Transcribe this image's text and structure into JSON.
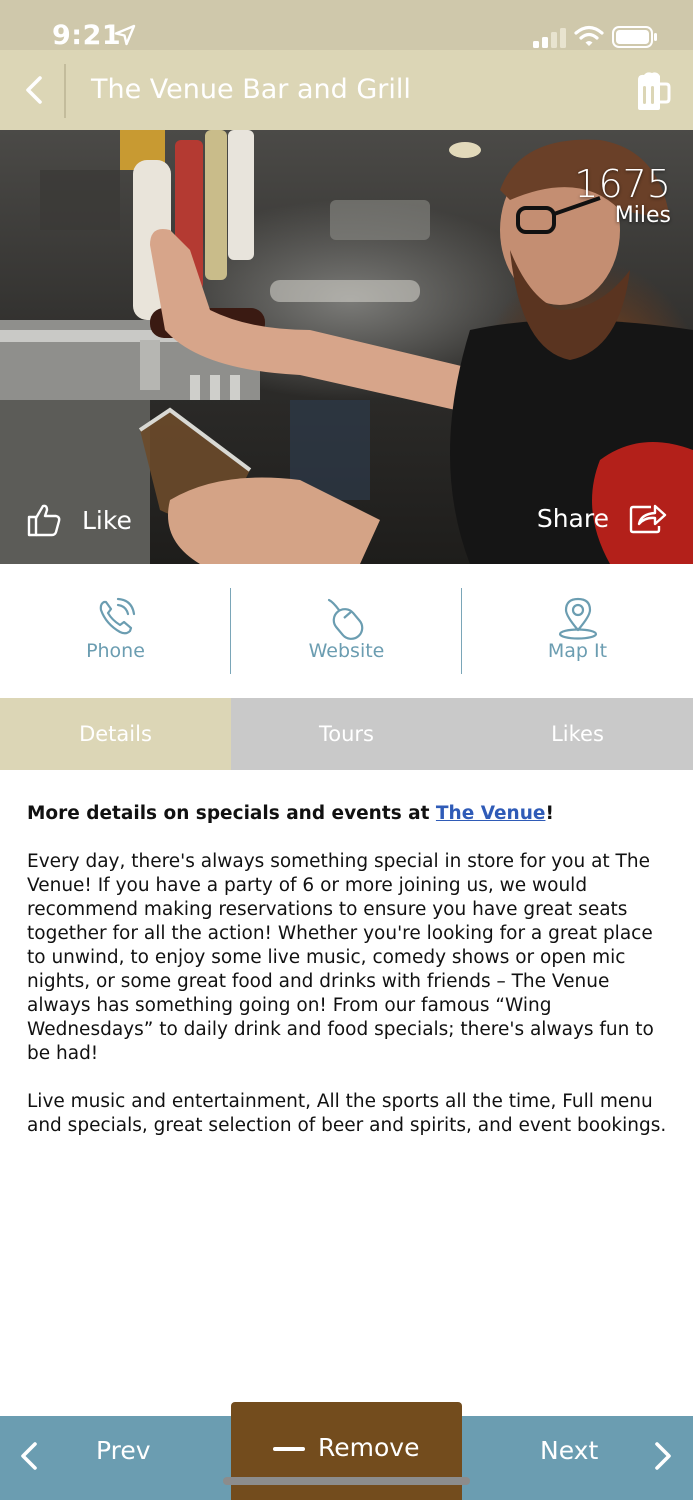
{
  "status_bar": {
    "time": "9:21",
    "icons": [
      "location-arrow-icon",
      "cellular-signal-icon",
      "wifi-icon",
      "battery-icon"
    ]
  },
  "header": {
    "title": "The Venue Bar and Grill",
    "back_icon": "chevron-left-icon",
    "right_icon": "beer-mug-icon"
  },
  "hero": {
    "distance_value": "1675",
    "distance_unit": "Miles",
    "like_label": "Like",
    "like_icon": "thumbs-up-icon",
    "share_label": "Share",
    "share_icon": "share-arrow-icon"
  },
  "actions": [
    {
      "label": "Phone",
      "icon": "phone-icon"
    },
    {
      "label": "Website",
      "icon": "mouse-icon"
    },
    {
      "label": "Map It",
      "icon": "map-pin-icon"
    }
  ],
  "tabs": [
    {
      "label": "Details",
      "active": true
    },
    {
      "label": "Tours",
      "active": false
    },
    {
      "label": "Likes",
      "active": false
    }
  ],
  "details": {
    "lead_text": "More details on specials and events at ",
    "lead_link": "The Venue",
    "lead_suffix": "!",
    "paragraph_1": "Every day, there's always something special in store for you at The Venue! If you have a party of 6 or more joining us, we would recommend making reservations to ensure you have great seats together for all the action! Whether you're looking for a great place to unwind, to enjoy some live music, comedy shows or open mic nights, or some great food and drinks with friends – The Venue always has something going on! From our famous “Wing Wednesdays” to daily drink and food specials; there's always fun to be had!",
    "paragraph_2": "Live music and entertainment, All the sports all the time, Full menu and specials, great selection of beer and spirits, and event bookings."
  },
  "bottom_nav": {
    "prev_label": "Prev",
    "remove_label": "Remove",
    "next_label": "Next"
  },
  "colors": {
    "header_bg": "#dcd6b6",
    "status_bg": "#cfc8ab",
    "accent_blue": "#6b9db1",
    "remove_brown": "#734c1d",
    "tab_inactive": "#c9c9c9",
    "link": "#2f5bb7"
  }
}
